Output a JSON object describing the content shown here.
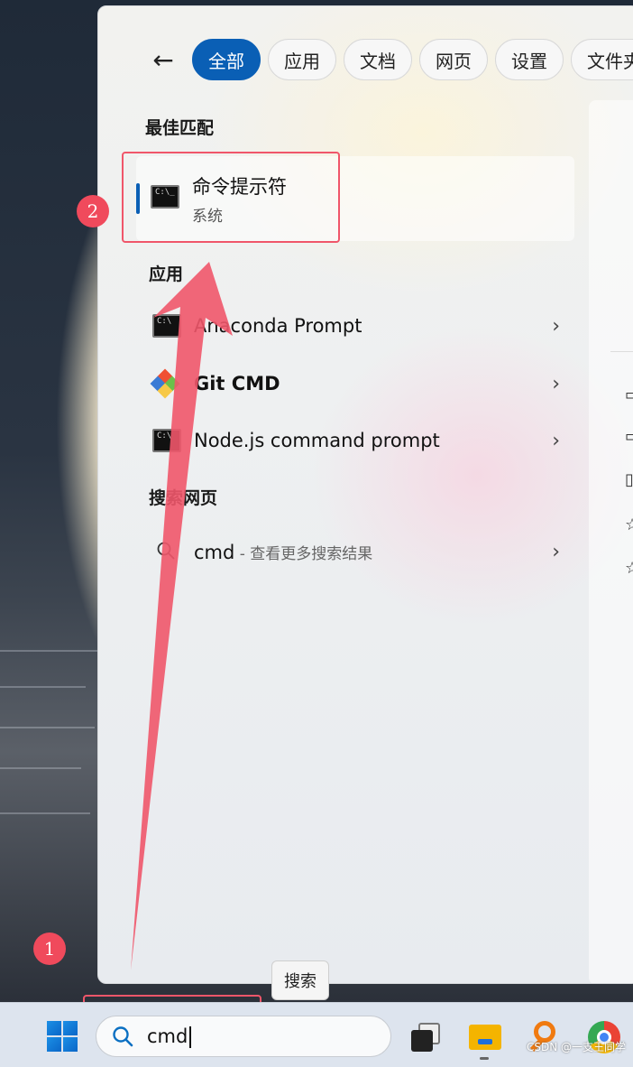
{
  "panel": {
    "tabs": [
      "全部",
      "应用",
      "文档",
      "网页",
      "设置",
      "文件夹"
    ],
    "best_match_title": "最佳匹配",
    "best_match": {
      "name": "命令提示符",
      "type": "系统"
    },
    "apps_title": "应用",
    "apps": [
      {
        "label": "Anaconda Prompt"
      },
      {
        "label": "Git CMD"
      },
      {
        "label": "Node.js command prompt"
      }
    ],
    "web_title": "搜索网页",
    "web_result": {
      "query": "cmd",
      "sub": " - 查看更多搜索结果"
    }
  },
  "annotations": {
    "badge_1": "1",
    "badge_2": "2",
    "arrow_color": "#f0566a"
  },
  "tooltip": "搜索",
  "taskbar": {
    "search_value": "cmd"
  },
  "watermark": "CSDN @一支王同学",
  "colors": {
    "accent": "#0a5fb5",
    "annotation_red": "#f0566a"
  }
}
